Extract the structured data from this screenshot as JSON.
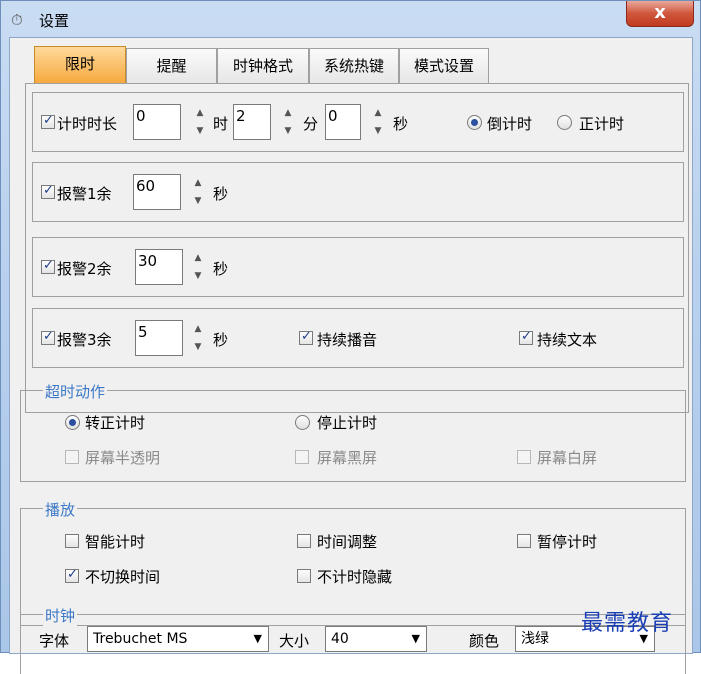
{
  "window": {
    "title": "设置",
    "close_label": "x"
  },
  "tabs": [
    "限时",
    "提醒",
    "时钟格式",
    "系统热键",
    "模式设置"
  ],
  "timer_row": {
    "checkbox_label": "计时时长",
    "hours_value": "0",
    "hours_unit": "时",
    "minutes_value": "2",
    "minutes_unit": "分",
    "seconds_value": "0",
    "seconds_unit": "秒",
    "countdown_label": "倒计时",
    "countup_label": "正计时"
  },
  "alarm1": {
    "label": "报警1余",
    "value": "60",
    "unit": "秒"
  },
  "alarm2": {
    "label": "报警2余",
    "value": "30",
    "unit": "秒"
  },
  "alarm3": {
    "label": "报警3余",
    "value": "5",
    "unit": "秒",
    "sound_label": "持续播音",
    "text_label": "持续文本"
  },
  "timeout": {
    "title": "超时动作",
    "to_countup": "转正计时",
    "stop": "停止计时",
    "semi_transparent": "屏幕半透明",
    "black_screen": "屏幕黑屏",
    "white_screen": "屏幕白屏"
  },
  "playback": {
    "title": "播放",
    "smart_timing": "智能计时",
    "time_adjust": "时间调整",
    "pause_timing": "暂停计时",
    "no_switch_time": "不切换时间",
    "hide_when_not_timing": "不计时隐藏"
  },
  "clock": {
    "title": "时钟",
    "font_label": "字体",
    "font_value": "Trebuchet MS",
    "size_label": "大小",
    "size_value": "40",
    "color_label": "颜色",
    "color_value": "浅绿"
  },
  "watermark": "最需教育",
  "colors": {
    "active_tab": "#f7a83b",
    "group_title": "#3c78c8",
    "close": "#c03a1f"
  }
}
